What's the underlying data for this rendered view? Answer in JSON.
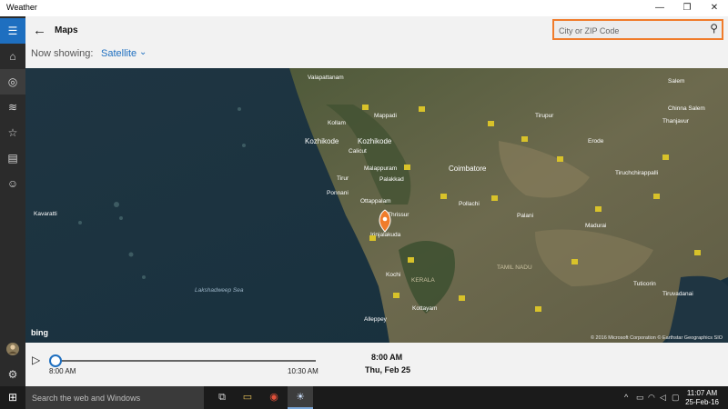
{
  "app": {
    "title": "Weather"
  },
  "window_controls": {
    "minimize": "—",
    "maximize": "❐",
    "close": "✕"
  },
  "sidebar": {
    "items": [
      {
        "icon": "hamburger-icon",
        "glyph": "☰"
      },
      {
        "icon": "home-icon",
        "glyph": "⌂"
      },
      {
        "icon": "maps-icon",
        "glyph": "◎"
      },
      {
        "icon": "historical-chart-icon",
        "glyph": "≋"
      },
      {
        "icon": "places-star-icon",
        "glyph": "☆"
      },
      {
        "icon": "news-icon",
        "glyph": "▤"
      },
      {
        "icon": "feedback-smiley-icon",
        "glyph": "☺"
      }
    ],
    "bottom": [
      {
        "icon": "avatar-icon"
      },
      {
        "icon": "settings-gear-icon",
        "glyph": "⚙"
      }
    ]
  },
  "header": {
    "back_glyph": "←",
    "title": "Maps",
    "now_showing_label": "Now showing:",
    "now_showing_value": "Satellite",
    "chevron": "⌄",
    "search": {
      "placeholder": "City or ZIP Code",
      "value": "",
      "icon_glyph": "⚲"
    }
  },
  "map": {
    "attribution": "bing",
    "copyright": "© 2016 Microsoft Corporation  © Earthstar Geographics SIO",
    "labels": {
      "valapattanam": "Valapattanam",
      "kollam": "Kollam",
      "kozhikode_sea": "Kozhikode",
      "kozhikode": "Kozhikode",
      "calicut": "Calicut",
      "mappadi": "Mappadi",
      "malappuram": "Malappuram",
      "ponnani": "Ponnani",
      "tirur": "Tirur",
      "palakkad": "Palakkad",
      "ottappalam": "Ottappalam",
      "thrissur": "Thrissur",
      "coimbatore": "Coimbatore",
      "irinjalakuda": "Irinjalakuda",
      "kochi": "Kochi",
      "kerala": "KERALA",
      "tamil_nadu": "TAMIL NADU",
      "alleppey": "Alleppey",
      "kottayam": "Kottayam",
      "kavaratti": "Kavaratti",
      "lakshadweep_sea": "Lakshadweep Sea",
      "pollachi": "Pollachi",
      "palani": "Palani",
      "madurai": "Madurai",
      "tiruchchirappalli": "Tiruchchirappalli",
      "thanjavur": "Thanjavur",
      "tuticorin": "Tuticorin",
      "tiruvadanai": "Tiruvadanai",
      "chinna_salem": "Chinna Salem",
      "tirupur": "Tirupur",
      "salem": "Salem",
      "erode": "Erode"
    }
  },
  "timeline": {
    "play_glyph": "▷",
    "start_time": "8:00 AM",
    "end_time": "10:30 AM",
    "current_time": "8:00 AM",
    "current_date": "Thu, Feb 25",
    "progress": 0
  },
  "taskbar": {
    "start_glyph": "⊞",
    "search_placeholder": "Search the web and Windows",
    "apps": [
      {
        "icon": "task-view-icon",
        "glyph": "⧉"
      },
      {
        "icon": "file-explorer-icon",
        "glyph": "▭"
      },
      {
        "icon": "chrome-icon",
        "glyph": "◉"
      },
      {
        "icon": "weather-app-icon",
        "glyph": "☀"
      }
    ],
    "tray": {
      "chevron": "^",
      "battery": "▭",
      "network": "◠",
      "volume": "◁",
      "message": "▢"
    },
    "clock": {
      "time": "11:07 AM",
      "date": "25-Feb-16"
    }
  },
  "colors": {
    "accent": "#1e6fc0",
    "search_border": "#f07c2b",
    "map_pin": "#f07c2b"
  }
}
